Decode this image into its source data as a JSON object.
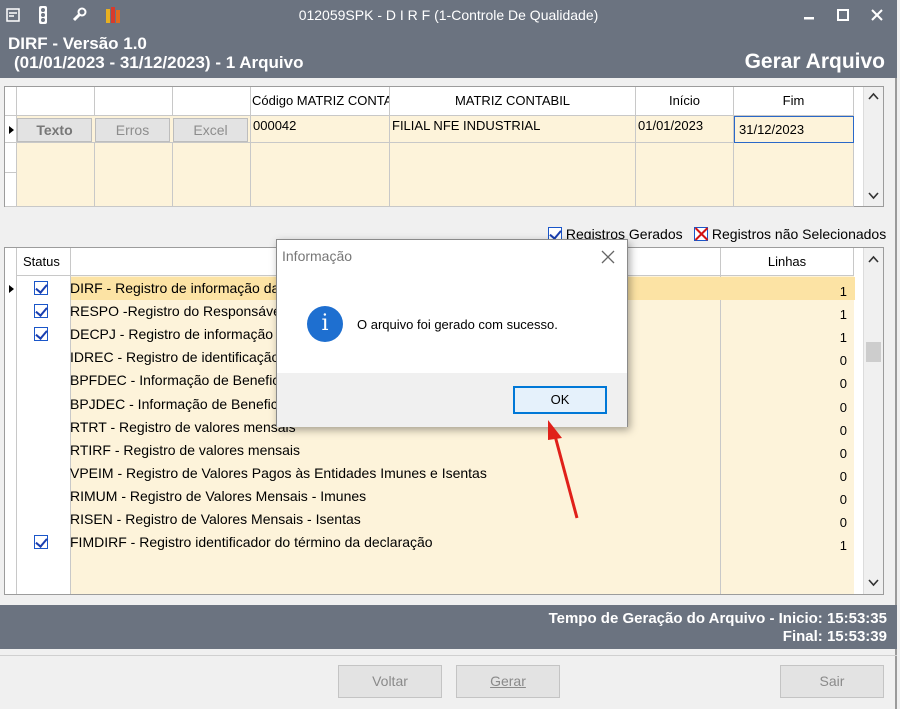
{
  "titlebar": {
    "title": "012059SPK - D I R F (1-Controle De Qualidade)"
  },
  "header": {
    "line1": "DIRF - Versão 1.0",
    "line2": "(01/01/2023 - 31/12/2023) - 1 Arquivo",
    "action": "Gerar Arquivo"
  },
  "top_grid": {
    "columns": [
      "Código MATRIZ CONTA",
      "MATRIZ CONTABIL",
      "Início",
      "Fim"
    ],
    "buttons": {
      "texto": "Texto",
      "erros": "Erros",
      "excel": "Excel"
    },
    "row": {
      "codigo": "000042",
      "matriz": "FILIAL NFE INDUSTRIAL",
      "inicio": "01/01/2023",
      "fim": "31/12/2023"
    }
  },
  "legend": {
    "gerados": "Registros Gerados",
    "nao_selecionados": "Registros não Selecionados"
  },
  "records_grid": {
    "status_header": "Status",
    "lines_header": "Linhas",
    "rows": [
      {
        "desc": "DIRF - Registro de informação da declaração",
        "lines": "1",
        "checked": true
      },
      {
        "desc": "RESPO -Registro do Responsável pelo preenchimento",
        "lines": "1",
        "checked": true
      },
      {
        "desc": "DECPJ - Registro de informação do declarante pessoa jurídica",
        "lines": "1",
        "checked": true
      },
      {
        "desc": "IDREC - Registro de identificação do código de receita",
        "lines": "0",
        "checked": false
      },
      {
        "desc": "BPFDEC - Informação de Beneficiário Pessoa Física",
        "lines": "0",
        "checked": false
      },
      {
        "desc": "BPJDEC - Informação de Beneficiário Pessoa Jurídica",
        "lines": "0",
        "checked": false
      },
      {
        "desc": "RTRT - Registro de valores mensais",
        "lines": "0",
        "checked": false
      },
      {
        "desc": "RTIRF - Registro de valores mensais",
        "lines": "0",
        "checked": false
      },
      {
        "desc": "VPEIM - Registro de Valores Pagos às Entidades Imunes e Isentas",
        "lines": "0",
        "checked": false
      },
      {
        "desc": "RIMUM - Registro de Valores Mensais - Imunes",
        "lines": "0",
        "checked": false
      },
      {
        "desc": "RISEN - Registro de Valores Mensais - Isentas",
        "lines": "0",
        "checked": false
      },
      {
        "desc": "FIMDIRF - Registro identificador do término da declaração",
        "lines": "1",
        "checked": true
      }
    ]
  },
  "status_bar": {
    "line1": "Tempo de Geração do Arquivo - Inicio: 15:53:35",
    "line2": "Final: 15:53:39"
  },
  "buttons": {
    "voltar": "Voltar",
    "gerar": "Gerar",
    "sair": "Sair"
  },
  "dialog": {
    "title": "Informação",
    "message": "O arquivo  foi gerado com sucesso.",
    "ok": "OK"
  },
  "colors": {
    "accent": "#6b7380",
    "row_highlight": "#fdf3da",
    "arrow": "#e0201a"
  }
}
